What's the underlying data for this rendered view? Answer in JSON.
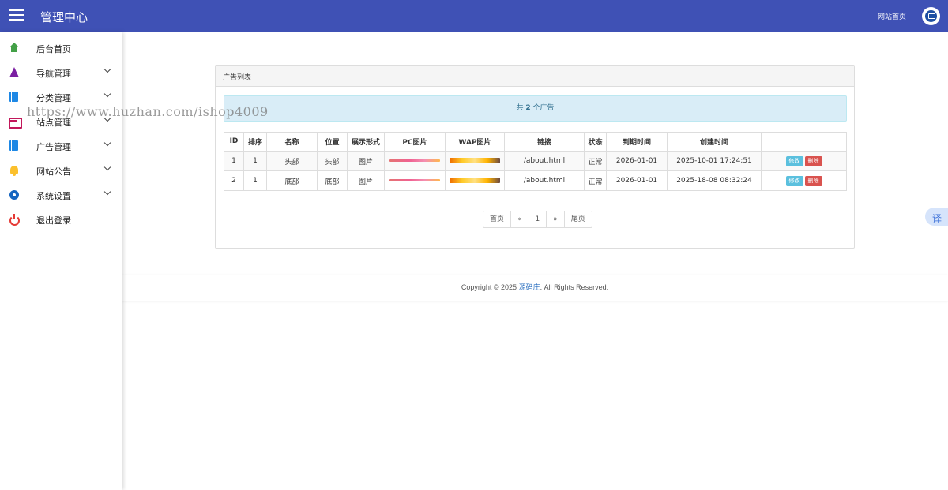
{
  "header": {
    "title": "管理中心",
    "site_home": "网站首页"
  },
  "sidebar": {
    "items": [
      {
        "label": "后台首页",
        "icon": "home-icon",
        "color": "#43a047",
        "expandable": false
      },
      {
        "label": "导航管理",
        "icon": "navigation-icon",
        "color": "#7b1fa2",
        "expandable": true
      },
      {
        "label": "分类管理",
        "icon": "book-icon",
        "color": "#1e88e5",
        "expandable": true
      },
      {
        "label": "站点管理",
        "icon": "card-icon",
        "color": "#c2185b",
        "expandable": true
      },
      {
        "label": "广告管理",
        "icon": "book-icon",
        "color": "#1e88e5",
        "expandable": true
      },
      {
        "label": "网站公告",
        "icon": "bell-icon",
        "color": "#fbc02d",
        "expandable": true
      },
      {
        "label": "系统设置",
        "icon": "gear-icon",
        "color": "#1565c0",
        "expandable": true
      },
      {
        "label": "退出登录",
        "icon": "power-icon",
        "color": "#e53935",
        "expandable": false
      }
    ]
  },
  "watermark": "https://www.huzhan.com/ishop4009",
  "panel": {
    "title": "广告列表",
    "alert_prefix": "共",
    "alert_count": "2",
    "alert_suffix": "个广告"
  },
  "table": {
    "columns": [
      "ID",
      "排序",
      "名称",
      "位置",
      "展示形式",
      "PC图片",
      "WAP图片",
      "链接",
      "状态",
      "到期时间",
      "创建时间",
      ""
    ],
    "rows": [
      {
        "id": "1",
        "sort": "1",
        "name": "头部",
        "position": "头部",
        "display": "图片",
        "link": "/about.html",
        "status": "正常",
        "expire": "2026-01-01",
        "created": "2025-10-01 17:24:51"
      },
      {
        "id": "2",
        "sort": "1",
        "name": "底部",
        "position": "底部",
        "display": "图片",
        "link": "/about.html",
        "status": "正常",
        "expire": "2026-01-01",
        "created": "2025-18-08 08:32:24"
      }
    ],
    "edit_label": "修改",
    "delete_label": "删除"
  },
  "pagination": {
    "first": "首页",
    "prev": "«",
    "current": "1",
    "next": "»",
    "last": "尾页"
  },
  "footer": {
    "prefix": "Copyright © 2025",
    "brand": "源码庄",
    "suffix": ". All Rights Reserved."
  },
  "translate_label": "译",
  "colors": {
    "header_bg": "#3f51b5",
    "alert_bg": "#d9edf7",
    "edit_btn": "#5bc0de",
    "delete_btn": "#d9534f"
  }
}
